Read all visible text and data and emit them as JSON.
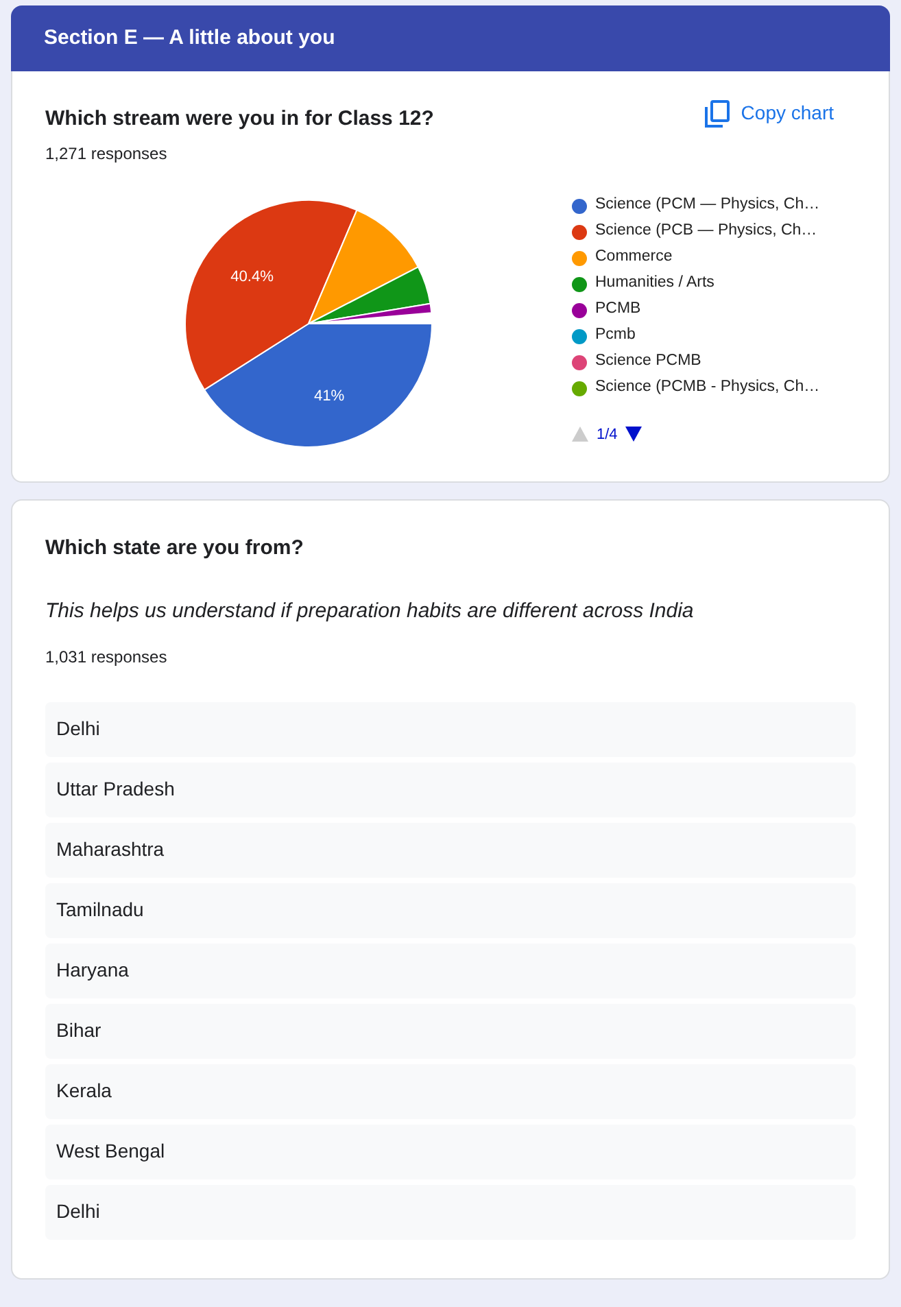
{
  "section_title": "Section E — A little about you",
  "questions": [
    {
      "kind": "chart",
      "title": "Which stream were you in for Class 12?",
      "responses": "1,271 responses",
      "copy_label": "Copy chart",
      "chart_data": {
        "type": "pie",
        "categories": [
          "Science (PCM — Physics, Ch…",
          "Science (PCB — Physics, Ch…",
          "Commerce",
          "Humanities / Arts",
          "PCMB",
          "Pcmb",
          "Science PCMB",
          "Science (PCMB - Physics, Ch…"
        ],
        "values": [
          41,
          40.4,
          11,
          5,
          1.2,
          null,
          null,
          null
        ],
        "colors": [
          "#3366cc",
          "#dc3912",
          "#ff9900",
          "#109618",
          "#990099",
          "#0099c6",
          "#dd4477",
          "#66aa00"
        ],
        "value_labels": [
          "41%",
          "40.4%",
          null,
          null,
          null,
          null,
          null,
          null
        ]
      },
      "pager": {
        "text": "1/4",
        "prev_disabled": true,
        "next_disabled": false
      }
    },
    {
      "kind": "list",
      "title": "Which state are you from?",
      "description": "This helps us understand if preparation habits are different across India",
      "responses": "1,031 responses",
      "answers": [
        "Delhi",
        "Uttar Pradesh",
        "Maharashtra",
        "Tamilnadu",
        "Haryana",
        "Bihar",
        "Kerala",
        "West Bengal",
        "Delhi"
      ]
    }
  ]
}
